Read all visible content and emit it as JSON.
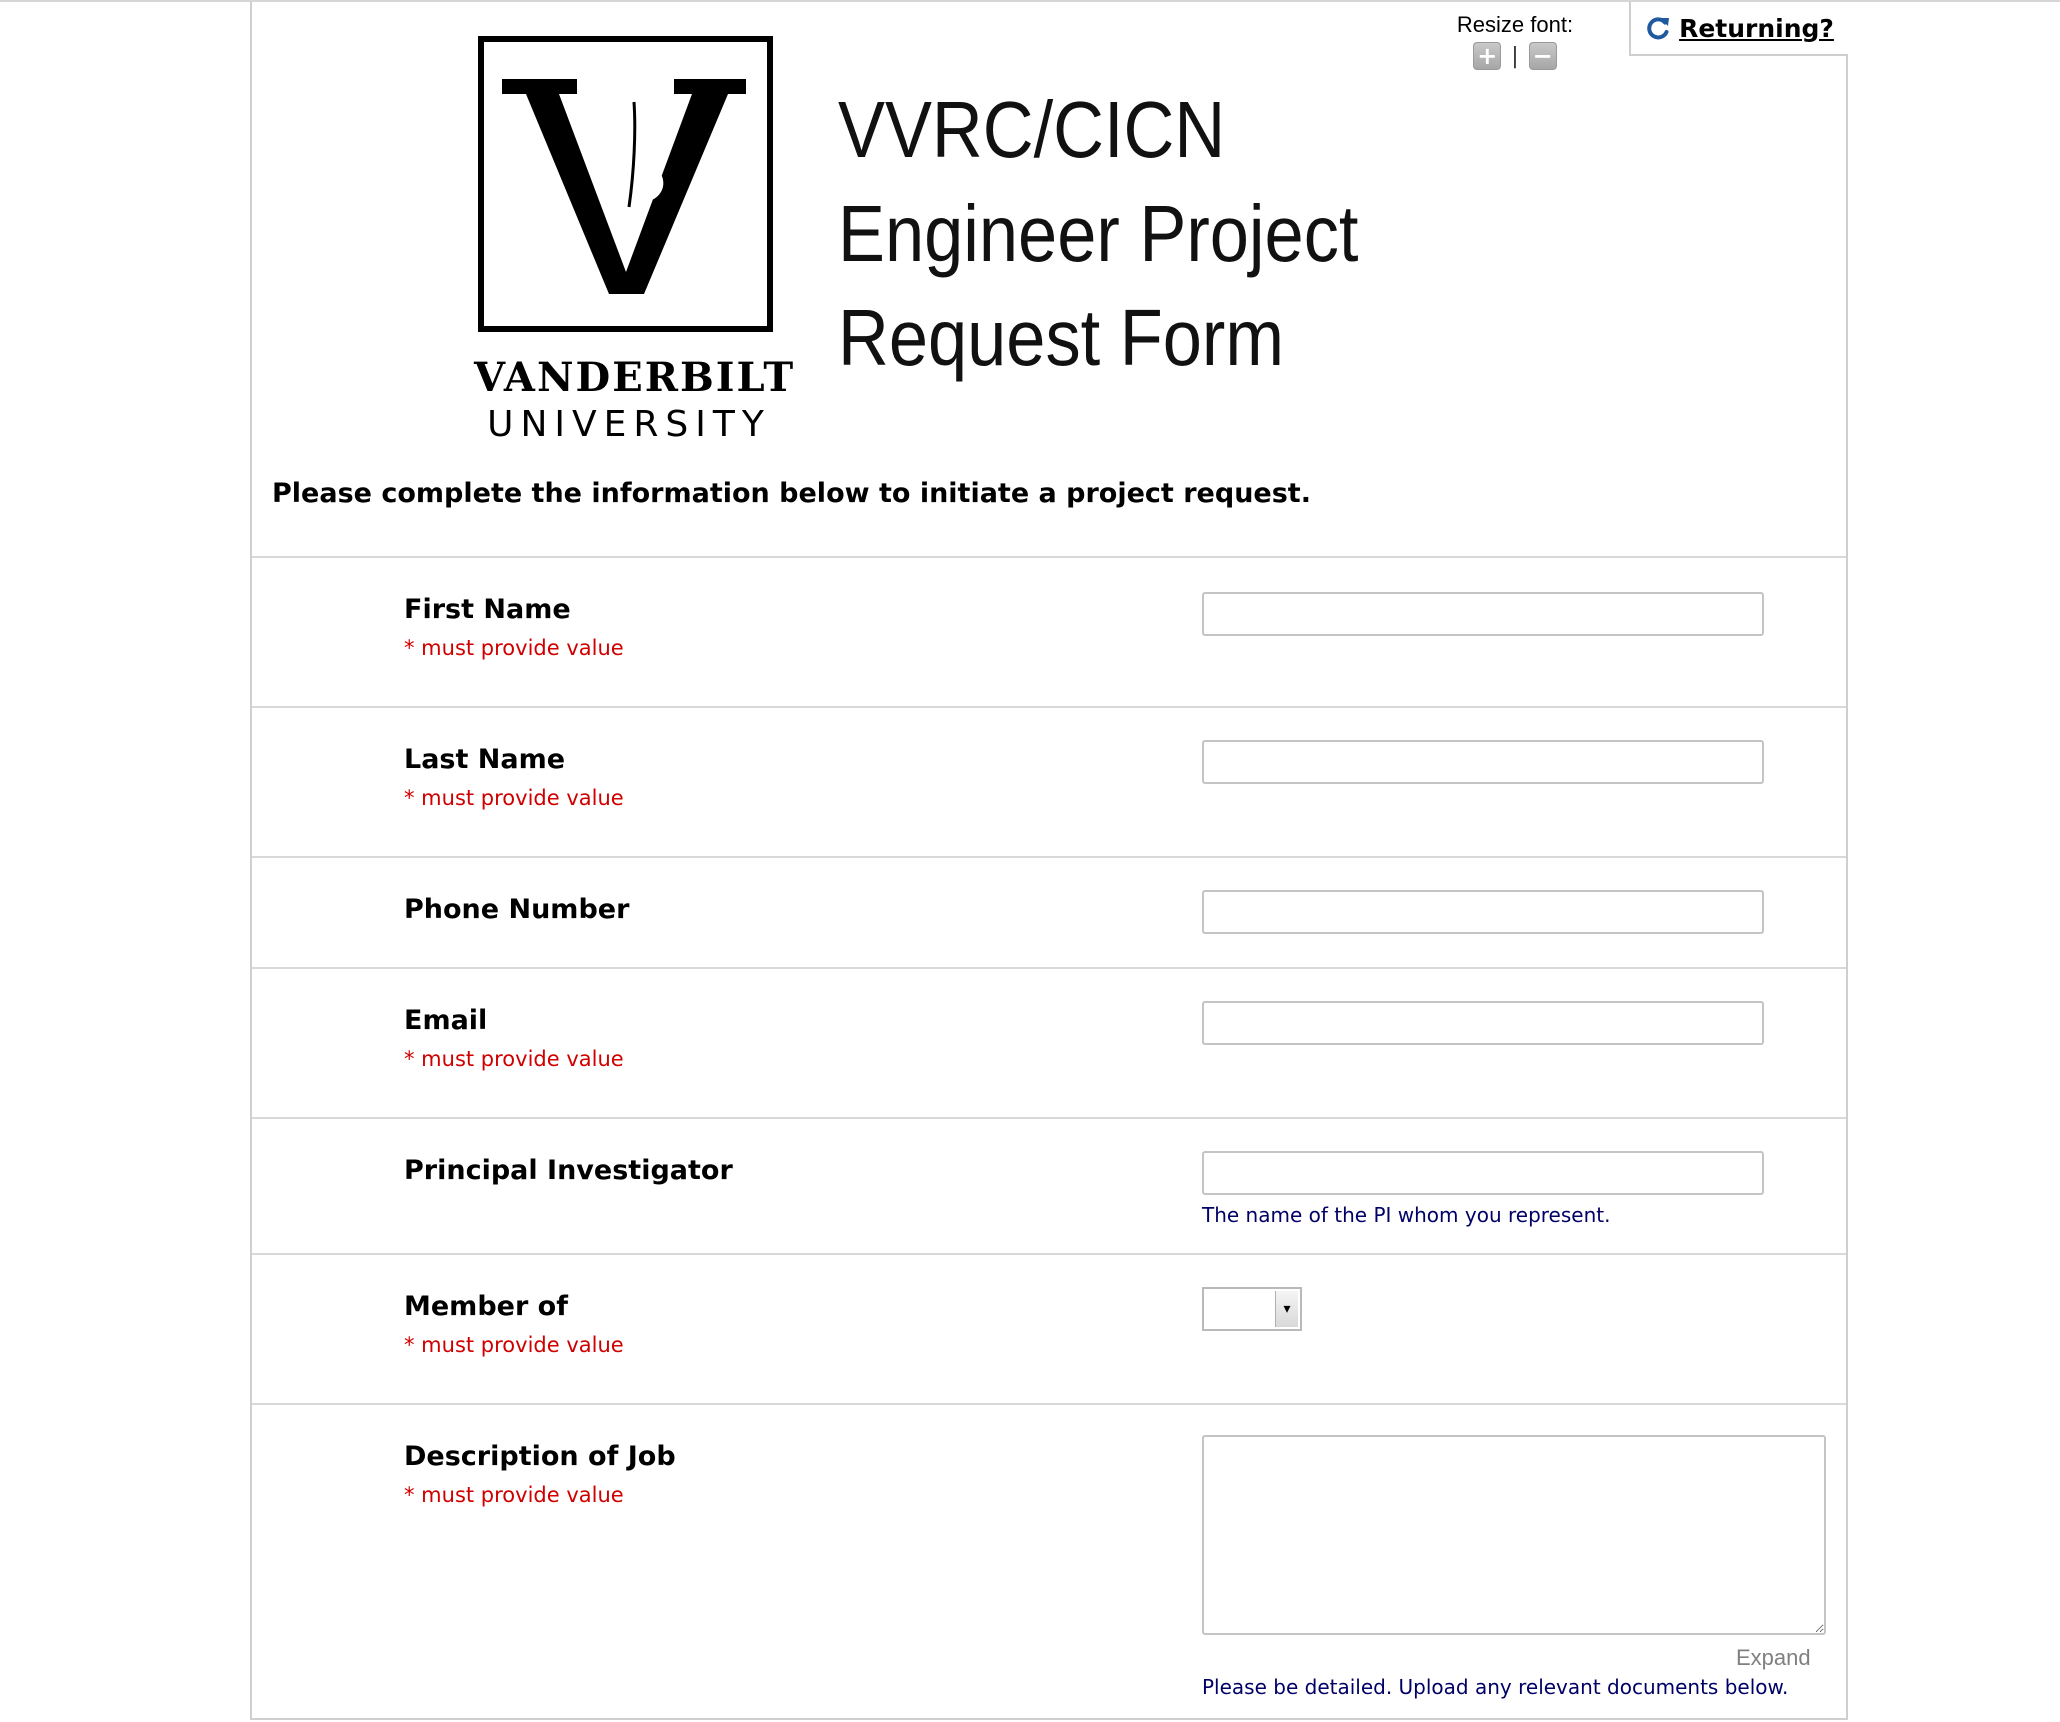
{
  "header": {
    "resize_font_label": "Resize font:",
    "resize_increase_symbol": "+",
    "resize_separator": "|",
    "resize_decrease_symbol": "−",
    "returning_label": "Returning?"
  },
  "logo": {
    "name": "VANDERBILT",
    "sub": "UNIVERSITY"
  },
  "title": {
    "line1": "VVRC/CICN",
    "line2": "Engineer Project",
    "line3": "Request Form"
  },
  "intro": "Please complete the information below to initiate a project request.",
  "form": {
    "required_text": "* must provide value",
    "first_name": {
      "label": "First Name",
      "value": ""
    },
    "last_name": {
      "label": "Last Name",
      "value": ""
    },
    "phone": {
      "label": "Phone Number",
      "value": ""
    },
    "email": {
      "label": "Email",
      "value": ""
    },
    "pi": {
      "label": "Principal Investigator",
      "value": "",
      "note": "The name of the PI whom you represent."
    },
    "member_of": {
      "label": "Member of",
      "selected": ""
    },
    "description": {
      "label": "Description of Job",
      "value": "",
      "expand_label": "Expand",
      "note": "Please be detailed. Upload any relevant documents below."
    }
  },
  "icons": {
    "returning": "refresh-icon",
    "increase": "plus-icon",
    "decrease": "minus-icon",
    "dropdown": "caret-down-icon"
  },
  "colors": {
    "required": "#d00000",
    "note": "#000066",
    "returning_icon": "#1f5aa0"
  }
}
